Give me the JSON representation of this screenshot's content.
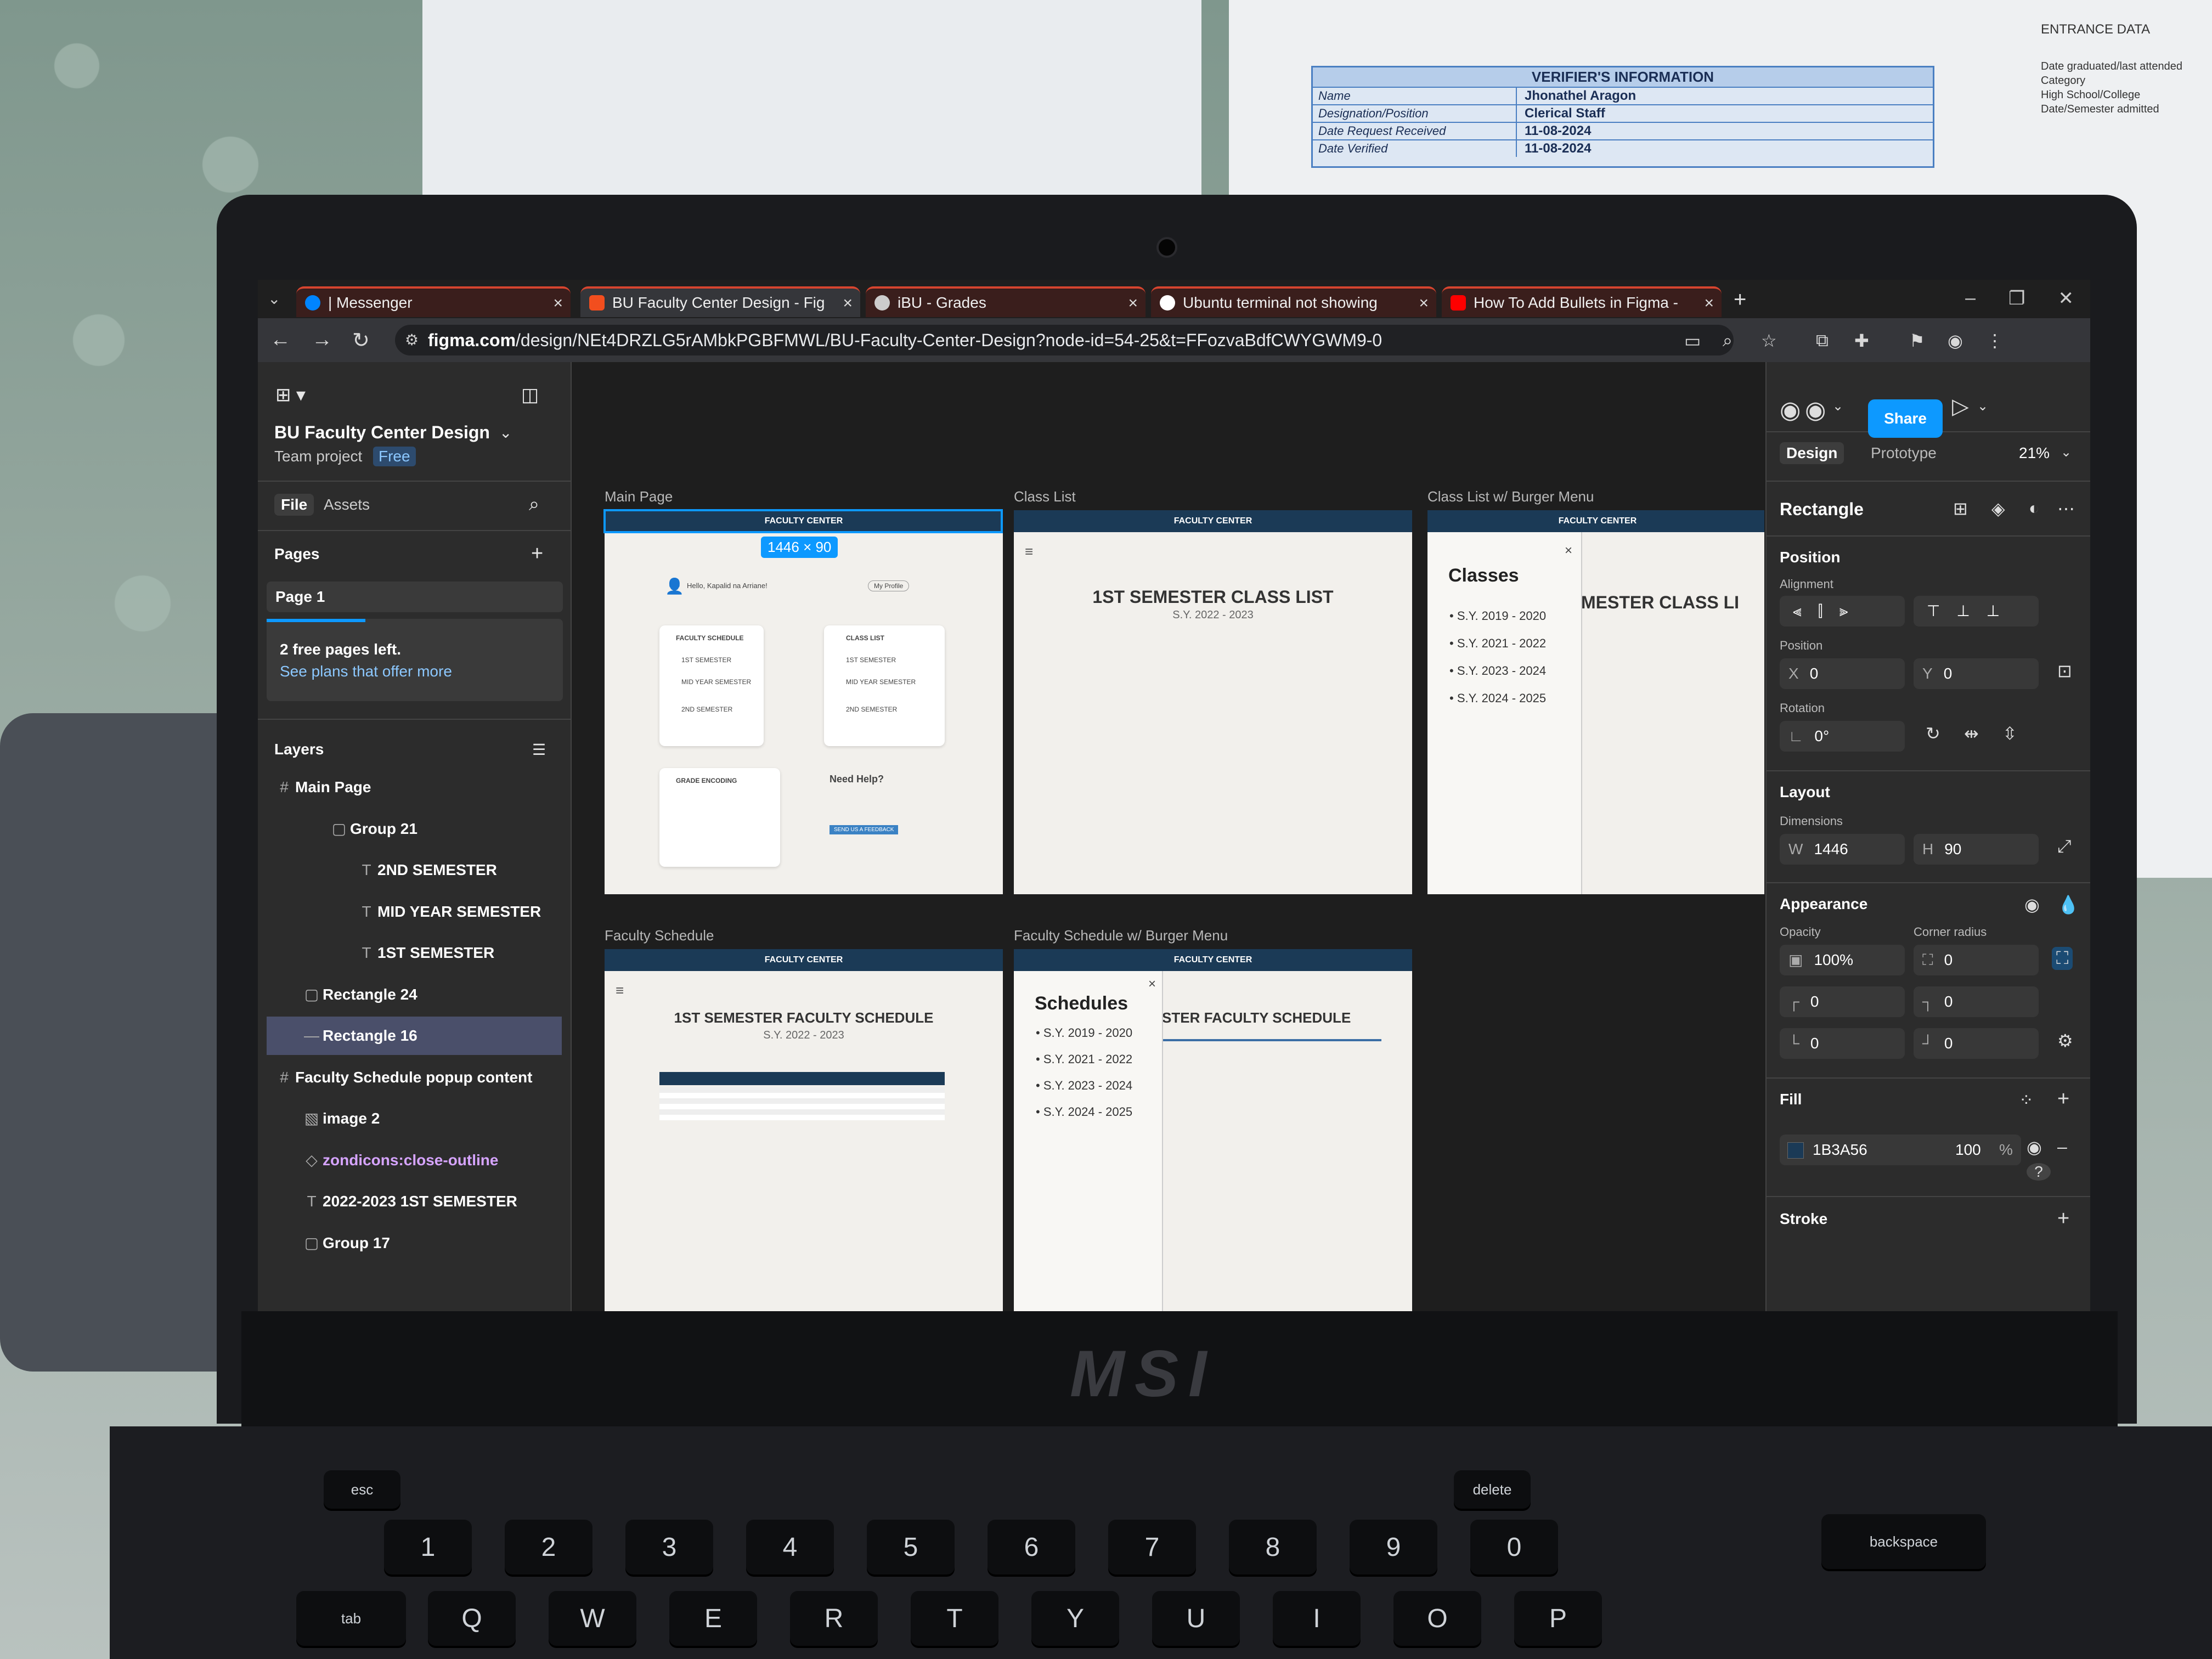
{
  "background": {
    "verifier": {
      "title": "VERIFIER'S INFORMATION",
      "rows": [
        {
          "label": "Name",
          "value": "Jhonathel Aragon"
        },
        {
          "label": "Designation/Position",
          "value": "Clerical Staff"
        },
        {
          "label": "Date Request Received",
          "value": "11-08-2024"
        },
        {
          "label": "Date Verified",
          "value": "11-08-2024"
        }
      ]
    },
    "entrance": {
      "title": "ENTRANCE DATA",
      "lines": [
        "Date graduated/last attended",
        "Category",
        "High School/College",
        "Date/Semester admitted"
      ]
    },
    "laptop_brand": "MSI"
  },
  "browser": {
    "tabs": [
      {
        "label": "| Messenger",
        "accent": "#0084ff"
      },
      {
        "label": "BU Faculty Center Design - Fig",
        "accent": "#f24e1e"
      },
      {
        "label": "iBU - Grades",
        "accent": "#cccccc"
      },
      {
        "label": "Ubuntu terminal not showing",
        "accent": "#ffffff"
      },
      {
        "label": "How To Add Bullets in Figma -",
        "accent": "#ff0000"
      }
    ],
    "new_tab": "+",
    "url_host": "figma.com",
    "url_path": "/design/NEt4DRZLG5rAMbkPGBFMWL/BU-Faculty-Center-Design?node-id=54-25&t=FFozvaBdfCWYGWM9-0"
  },
  "figma": {
    "file_name": "BU Faculty Center Design",
    "team": "Team project",
    "plan_badge": "Free",
    "left_tabs": [
      "File",
      "Assets"
    ],
    "pages_heading": "Pages",
    "current_page": "Page 1",
    "free_pages_notice": "2 free pages left.",
    "plans_link": "See plans that offer more",
    "layers_heading": "Layers",
    "layers": [
      {
        "icon": "#",
        "label": "Main Page",
        "indent": 0
      },
      {
        "icon": "▢",
        "label": "Group 21",
        "indent": 2
      },
      {
        "icon": "T",
        "label": "2ND SEMESTER",
        "indent": 3
      },
      {
        "icon": "T",
        "label": "MID YEAR SEMESTER",
        "indent": 3
      },
      {
        "icon": "T",
        "label": "1ST SEMESTER",
        "indent": 3
      },
      {
        "icon": "▢",
        "label": "Rectangle 24",
        "indent": 1
      },
      {
        "icon": "—",
        "label": "Rectangle 16",
        "indent": 1,
        "selected": true
      },
      {
        "icon": "#",
        "label": "Faculty Schedule popup content",
        "indent": 0
      },
      {
        "icon": "▧",
        "label": "image 2",
        "indent": 1
      },
      {
        "icon": "◇",
        "label": "zondicons:close-outline",
        "indent": 1
      },
      {
        "icon": "T",
        "label": "2022-2023 1ST SEMESTER",
        "indent": 1
      },
      {
        "icon": "▢",
        "label": "Group 17",
        "indent": 1
      }
    ],
    "frames": {
      "main_page": {
        "label": "Main Page",
        "header": "FACULTY CENTER",
        "size_badge": "1446 × 90",
        "greeting": "Hello, Kapalid na Arriane!",
        "profile_btn": "My Profile",
        "schedule_card": "FACULTY SCHEDULE",
        "classlist_card": "CLASS LIST",
        "items": [
          "1ST SEMESTER",
          "MID YEAR SEMESTER",
          "2ND SEMESTER"
        ],
        "grade_card": "GRADE ENCODING",
        "help_title": "Need Help?",
        "help_btn": "SEND US A FEEDBACK"
      },
      "class_list": {
        "label": "Class List",
        "header": "FACULTY CENTER",
        "title": "1ST SEMESTER CLASS LIST",
        "subtitle": "S.Y. 2022 - 2023"
      },
      "class_list_burger": {
        "label": "Class List w/ Burger Menu",
        "header": "FACULTY CENTER",
        "popup_title": "Classes",
        "items": [
          "S.Y. 2019 - 2020",
          "S.Y. 2021 - 2022",
          "S.Y. 2023 - 2024",
          "S.Y. 2024 - 2025"
        ],
        "bg_title": "MESTER CLASS LI"
      },
      "faculty_schedule": {
        "label": "Faculty Schedule",
        "header": "FACULTY CENTER",
        "title": "1ST SEMESTER FACULTY SCHEDULE",
        "subtitle": "S.Y. 2022 - 2023"
      },
      "faculty_schedule_burger": {
        "label": "Faculty Schedule w/ Burger Menu",
        "header": "FACULTY CENTER",
        "popup_title": "Schedules",
        "items": [
          "S.Y. 2019 - 2020",
          "S.Y. 2021 - 2022",
          "S.Y. 2023 - 2024",
          "S.Y. 2024 - 2025"
        ],
        "bg_title": "STER FACULTY SCHEDULE"
      }
    },
    "right_panel": {
      "share": "Share",
      "tabs": [
        "Design",
        "Prototype"
      ],
      "zoom": "21%",
      "selection_type": "Rectangle",
      "position_heading": "Position",
      "alignment_label": "Alignment",
      "position_label": "Position",
      "x_label": "X",
      "x": "0",
      "y_label": "Y",
      "y": "0",
      "rotation_label": "Rotation",
      "rotation": "0°",
      "layout_heading": "Layout",
      "dimensions_label": "Dimensions",
      "w_label": "W",
      "w": "1446",
      "h_label": "H",
      "h": "90",
      "appearance_heading": "Appearance",
      "opacity_label": "Opacity",
      "opacity": "100%",
      "corner_radius_label": "Corner radius",
      "corner_radius": "0",
      "corners": [
        "0",
        "0",
        "0",
        "0"
      ],
      "fill_heading": "Fill",
      "fill_hex": "1B3A56",
      "fill_color": "#1B3A56",
      "fill_opacity": "100",
      "fill_pct": "%",
      "stroke_heading": "Stroke"
    }
  }
}
